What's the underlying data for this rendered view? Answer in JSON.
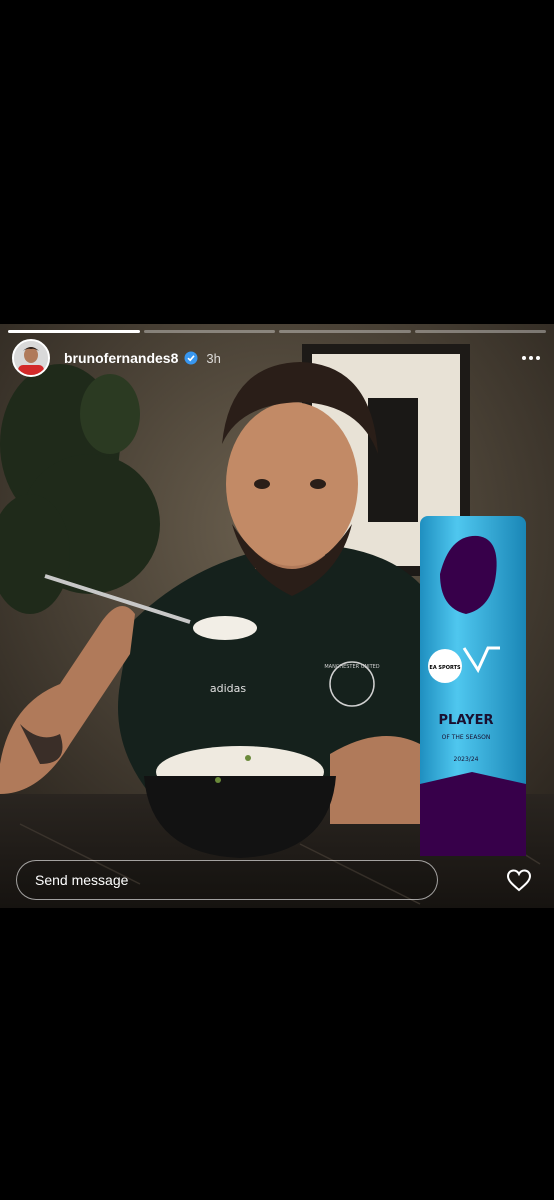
{
  "story": {
    "username": "brunofernandes8",
    "time_ago": "3h",
    "segments_viewed": [
      1,
      0,
      0,
      0
    ],
    "reply_placeholder": "Send message",
    "photo": {
      "shirt_brand": "adidas",
      "badge_text": "MANCHESTER UNITED",
      "tube_sponsor": "EA SPORTS",
      "tube_title": "PLAYER",
      "tube_subtitle": "OF THE SEASON",
      "tube_season": "2023/24"
    }
  },
  "icons": {
    "verified": "verified-badge-icon",
    "more": "more-options-icon",
    "like": "heart-icon"
  },
  "colors": {
    "tube_blue": "#2eb3e0",
    "tube_purple": "#37004a",
    "verified_blue": "#3897f0"
  }
}
